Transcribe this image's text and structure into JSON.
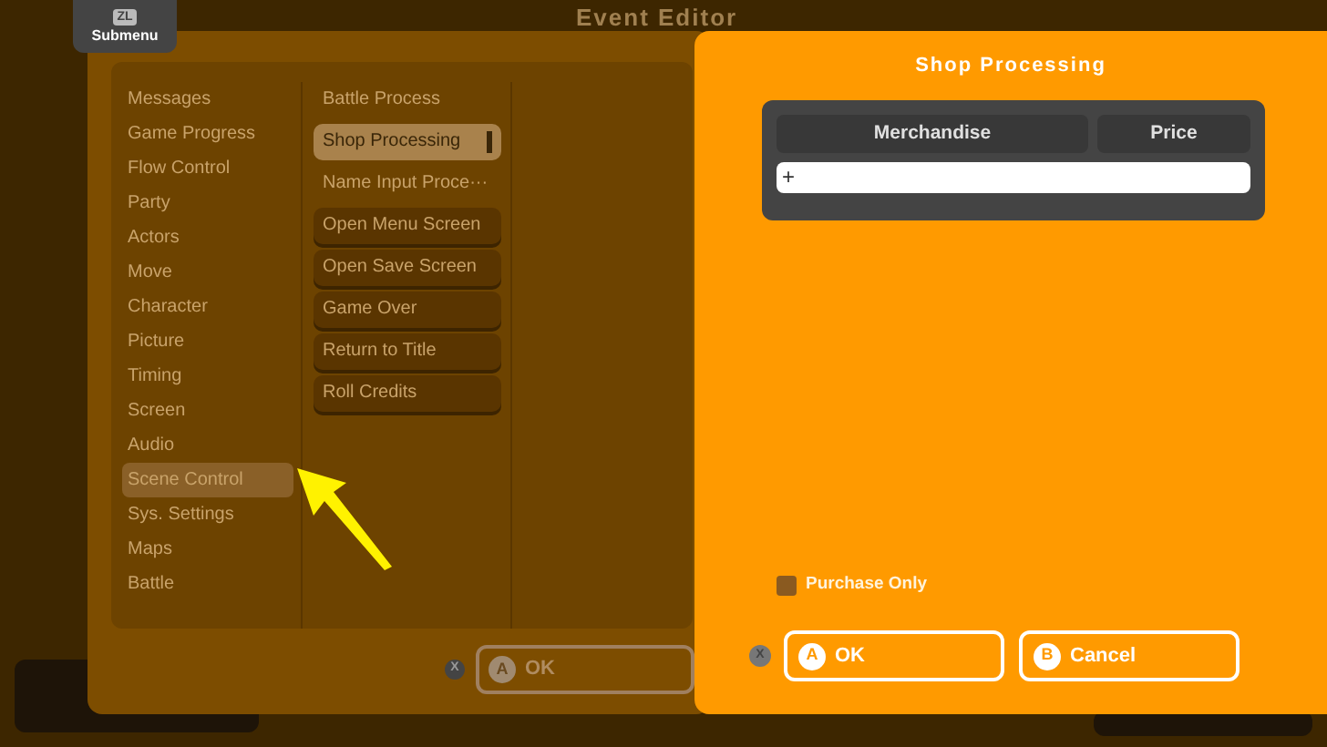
{
  "submenu_tab": {
    "key": "ZL",
    "label": "Submenu"
  },
  "editor": {
    "title": "Event Editor",
    "categories": [
      {
        "label": "Messages",
        "selected": false
      },
      {
        "label": "Game Progress",
        "selected": false
      },
      {
        "label": "Flow Control",
        "selected": false
      },
      {
        "label": "Party",
        "selected": false
      },
      {
        "label": "Actors",
        "selected": false
      },
      {
        "label": "Move",
        "selected": false
      },
      {
        "label": "Character",
        "selected": false
      },
      {
        "label": "Picture",
        "selected": false
      },
      {
        "label": "Timing",
        "selected": false
      },
      {
        "label": "Screen",
        "selected": false
      },
      {
        "label": "Audio",
        "selected": false
      },
      {
        "label": "Scene Control",
        "selected": true
      },
      {
        "label": "Sys. Settings",
        "selected": false
      },
      {
        "label": "Maps",
        "selected": false
      },
      {
        "label": "Battle",
        "selected": false
      }
    ],
    "commands": [
      {
        "label": "Battle Process",
        "kind": "text",
        "selected": false
      },
      {
        "label": "Shop Processing",
        "kind": "button",
        "selected": true
      },
      {
        "label": "Name Input Proce···",
        "kind": "text",
        "selected": false
      },
      {
        "label": "Open Menu Screen",
        "kind": "button",
        "selected": false
      },
      {
        "label": "Open Save Screen",
        "kind": "button",
        "selected": false
      },
      {
        "label": "Game Over",
        "kind": "button",
        "selected": false
      },
      {
        "label": "Return to Title",
        "kind": "button",
        "selected": false
      },
      {
        "label": "Roll Credits",
        "kind": "button",
        "selected": false
      }
    ],
    "close_key": "X",
    "ok_button": {
      "key": "A",
      "label": "OK"
    }
  },
  "dialog": {
    "title": "Shop Processing",
    "table": {
      "columns": [
        "Merchandise",
        "Price"
      ],
      "add_row": "+"
    },
    "purchase_only": {
      "label": "Purchase Only",
      "checked": false
    },
    "close_key": "X",
    "buttons": [
      {
        "key": "A",
        "label": "OK"
      },
      {
        "key": "B",
        "label": "Cancel"
      }
    ]
  }
}
